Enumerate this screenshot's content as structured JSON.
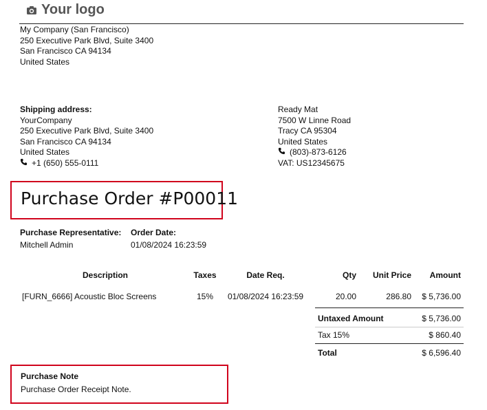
{
  "header": {
    "logo_text": "Your logo",
    "logo_icon": "camera-icon"
  },
  "company": {
    "name": "My Company (San Francisco)",
    "street": "250 Executive Park Blvd, Suite 3400",
    "city": "San Francisco CA 94134",
    "country": "United States"
  },
  "shipping": {
    "heading": "Shipping address:",
    "name": "YourCompany",
    "street": "250 Executive Park Blvd, Suite 3400",
    "city": "San Francisco CA 94134",
    "country": "United States",
    "phone": "+1 (650) 555-0111"
  },
  "vendor": {
    "name": "Ready Mat",
    "street": "7500 W Linne Road",
    "city": "Tracy CA 95304",
    "country": "United States",
    "phone": "(803)-873-6126",
    "vat": "VAT: US12345675"
  },
  "order": {
    "title": "Purchase Order #P00011",
    "rep_label": "Purchase Representative:",
    "rep_value": "Mitchell Admin",
    "date_label": "Order Date:",
    "date_value": "01/08/2024 16:23:59"
  },
  "table": {
    "headers": {
      "description": "Description",
      "taxes": "Taxes",
      "date_req": "Date Req.",
      "qty": "Qty",
      "unit_price": "Unit Price",
      "amount": "Amount"
    },
    "rows": [
      {
        "description": "[FURN_6666] Acoustic Bloc Screens",
        "taxes": "15%",
        "date_req": "01/08/2024 16:23:59",
        "qty": "20.00",
        "unit_price": "286.80",
        "amount": "$ 5,736.00"
      }
    ]
  },
  "totals": {
    "untaxed_label": "Untaxed Amount",
    "untaxed_value": "$ 5,736.00",
    "tax_label": "Tax 15%",
    "tax_value": "$ 860.40",
    "total_label": "Total",
    "total_value": "$ 6,596.40"
  },
  "note": {
    "heading": "Purchase Note",
    "text": "Purchase Order Receipt Note."
  },
  "colors": {
    "highlight": "#d0021b"
  }
}
